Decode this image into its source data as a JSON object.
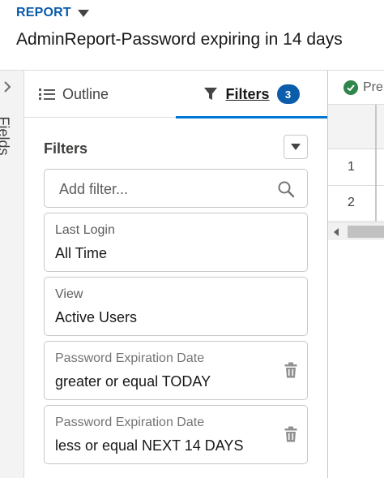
{
  "header": {
    "eyebrow": "REPORT",
    "title": "AdminReport-Password expiring in 14 days"
  },
  "fields_rail": {
    "label": "Fields",
    "chevron_icon": "chevron-right-icon"
  },
  "tabs": {
    "outline": {
      "label": "Outline",
      "icon": "list-icon"
    },
    "filters": {
      "label": "Filters",
      "icon": "funnel-icon",
      "badge": "3",
      "active": true
    }
  },
  "filters_panel": {
    "heading": "Filters",
    "dropdown_icon": "chevron-down-icon",
    "search": {
      "placeholder": "Add filter...",
      "value": "",
      "icon": "search-icon"
    },
    "items": [
      {
        "label": "Last Login",
        "value": "All Time",
        "removable": false
      },
      {
        "label": "View",
        "value": "Active Users",
        "removable": false
      },
      {
        "label": "Password Expiration Date",
        "value": "greater or equal TODAY",
        "removable": true
      },
      {
        "label": "Password Expiration Date",
        "value": "less or equal NEXT 14 DAYS",
        "removable": true
      }
    ]
  },
  "grid": {
    "tab_label": "Pre",
    "tab_icon": "check-circle-icon",
    "rows": [
      "1",
      "2"
    ]
  },
  "colors": {
    "accent": "#0176d3",
    "brand": "#0b5cab",
    "success": "#2e844a"
  }
}
